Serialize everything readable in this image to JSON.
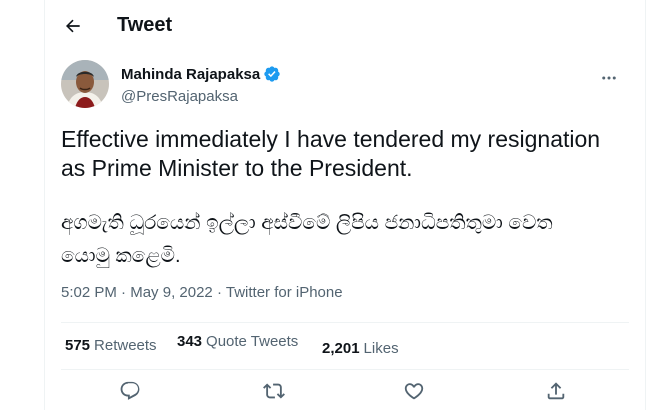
{
  "header": {
    "title": "Tweet"
  },
  "author": {
    "name": "Mahinda Rajapaksa",
    "handle": "@PresRajapaksa"
  },
  "tweet": {
    "text_en": "Effective immediately I have tendered my resignation\nas Prime Minister to the President.",
    "text_si": "අගමැති ධූරයෙන් ඉල්ලා අස්වීමේ ලිපිය ජනාධිපතිතුමා වෙත\nයොමු කළෙමි."
  },
  "meta": {
    "time": "5:02 PM",
    "separator": "·",
    "date": "May 9, 2022",
    "source": "Twitter for iPhone"
  },
  "stats": {
    "retweets_count": "575",
    "retweets_label": "Retweets",
    "quotes_count": "343",
    "quotes_label": "Quote Tweets",
    "likes_count": "2,201",
    "likes_label": "Likes"
  },
  "icons": {
    "back": "arrow-left-icon",
    "verified": "verified-badge-icon",
    "more": "more-horizontal-icon",
    "reply": "reply-icon",
    "retweet": "retweet-icon",
    "like": "heart-icon",
    "share": "share-icon"
  },
  "colors": {
    "text": "#0f1419",
    "secondary": "#536471",
    "verified": "#1d9bf0",
    "border": "#eff3f4"
  }
}
